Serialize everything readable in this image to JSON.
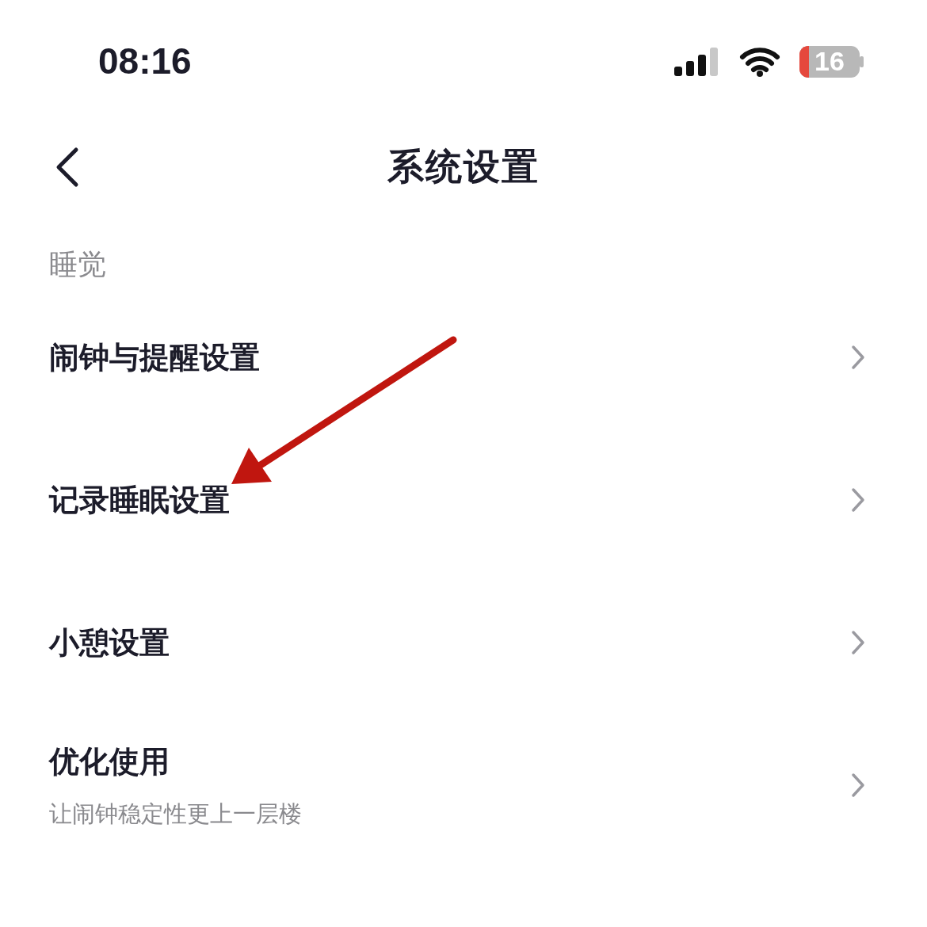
{
  "status_bar": {
    "time": "08:16",
    "battery": "16"
  },
  "header": {
    "title": "系统设置"
  },
  "sections": [
    {
      "title": "睡觉",
      "items": [
        {
          "label": "闹钟与提醒设置"
        },
        {
          "label": "记录睡眠设置"
        },
        {
          "label": "小憩设置"
        },
        {
          "label": "优化使用",
          "subtitle": "让闹钟稳定性更上一层楼"
        }
      ]
    }
  ],
  "annotation": {
    "kind": "arrow"
  }
}
